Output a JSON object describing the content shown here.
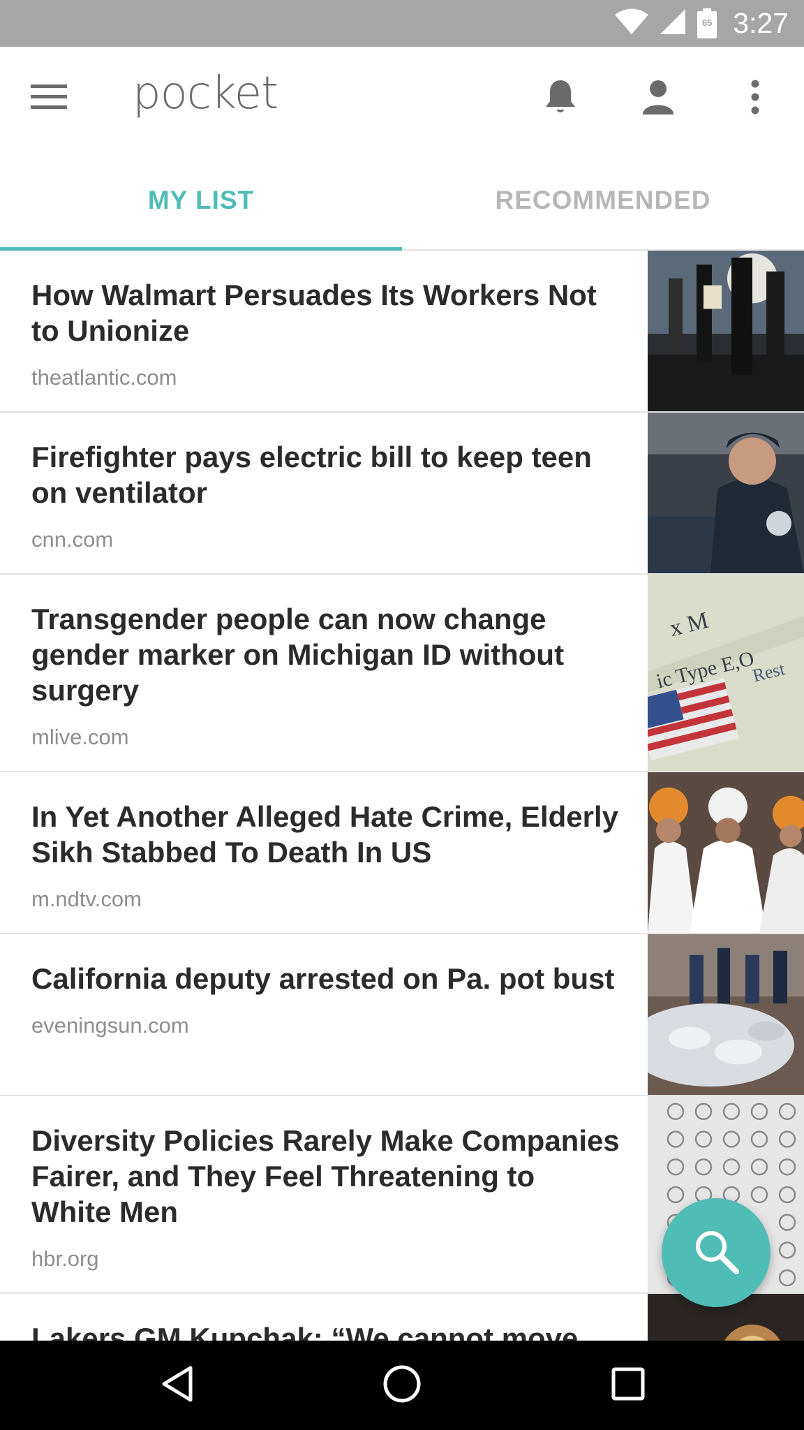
{
  "status_bar": {
    "time": "3:27",
    "battery_level": "65",
    "icons": [
      "wifi-icon",
      "cell-signal-icon",
      "battery-icon"
    ]
  },
  "toolbar": {
    "app_name": "pocket",
    "icons": [
      "menu-icon",
      "bell-icon",
      "profile-icon",
      "more-vert-icon"
    ]
  },
  "tabs": [
    {
      "label": "MY LIST",
      "selected": true
    },
    {
      "label": "RECOMMENDED",
      "selected": false
    }
  ],
  "articles": [
    {
      "title": "How Walmart Persuades Its Workers Not to Unionize",
      "domain": "theatlantic.com"
    },
    {
      "title": "Firefighter pays electric bill to keep teen on ventilator",
      "domain": "cnn.com"
    },
    {
      "title": "Transgender people can now change gender marker on Michigan ID without surgery",
      "domain": "mlive.com"
    },
    {
      "title": "In Yet Another Alleged Hate Crime, Elderly Sikh Stabbed To Death In US",
      "domain": "m.ndtv.com"
    },
    {
      "title": "California deputy arrested on Pa. pot bust",
      "domain": "eveningsun.com"
    },
    {
      "title": "Diversity Policies Rarely Make Companies Fairer, and They Feel Threatening to White Men",
      "domain": "hbr.org"
    },
    {
      "title": "Lakers GM Kupchak: “We cannot move",
      "domain": ""
    }
  ],
  "fab": {
    "icon": "search-icon"
  },
  "nav_bar": {
    "icons": [
      "back-icon",
      "home-icon",
      "recents-icon"
    ]
  },
  "colors": {
    "accent": "#50bcb6",
    "status_bar": "#a6a6a6",
    "title_text": "#2b2b2b",
    "domain_text": "#8e8e8e",
    "inactive_tab": "#b7b7b7"
  }
}
